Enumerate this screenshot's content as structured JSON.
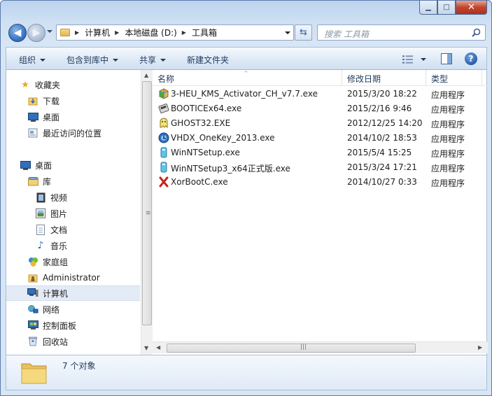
{
  "window": {
    "caption": {
      "minimize": "▁",
      "maximize": "□",
      "close": "✕"
    }
  },
  "address": {
    "segments": [
      "计算机",
      "本地磁盘 (D:)",
      "工具箱"
    ],
    "search_placeholder": "搜索 工具箱"
  },
  "toolbar": {
    "organize": "组织",
    "include_in_library": "包含到库中",
    "share": "共享",
    "new_folder": "新建文件夹",
    "help": "?"
  },
  "nav": {
    "favorites": {
      "label": "收藏夹",
      "items": [
        "下载",
        "桌面",
        "最近访问的位置"
      ]
    },
    "desktop": "桌面",
    "libraries": {
      "label": "库",
      "items": [
        "视频",
        "图片",
        "文档",
        "音乐"
      ]
    },
    "homegroup": "家庭组",
    "user": "Administrator",
    "computer": "计算机",
    "network": "网络",
    "control_panel": "控制面板",
    "recycle_bin": "回收站"
  },
  "columns": {
    "name": "名称",
    "date": "修改日期",
    "type": "类型"
  },
  "files": [
    {
      "name": "3-HEU_KMS_Activator_CH_v7.7.exe",
      "date": "2015/3/20 18:22",
      "type": "应用程序",
      "icon": "heu-kms-icon"
    },
    {
      "name": "BOOTICEx64.exe",
      "date": "2015/2/16 9:46",
      "type": "应用程序",
      "icon": "bootice-icon"
    },
    {
      "name": "GHOST32.EXE",
      "date": "2012/12/25 14:20",
      "type": "应用程序",
      "icon": "ghost-icon"
    },
    {
      "name": "VHDX_OneKey_2013.exe",
      "date": "2014/10/2 18:53",
      "type": "应用程序",
      "icon": "vhdx-onekey-icon"
    },
    {
      "name": "WinNTSetup.exe",
      "date": "2015/5/4 15:25",
      "type": "应用程序",
      "icon": "winntsetup-icon"
    },
    {
      "name": "WinNTSetup3_x64正式版.exe",
      "date": "2015/3/24 17:21",
      "type": "应用程序",
      "icon": "winntsetup3-icon"
    },
    {
      "name": "XorBootC.exe",
      "date": "2014/10/27 0:33",
      "type": "应用程序",
      "icon": "xorboot-icon"
    }
  ],
  "status": {
    "item_count": "7 个对象"
  }
}
